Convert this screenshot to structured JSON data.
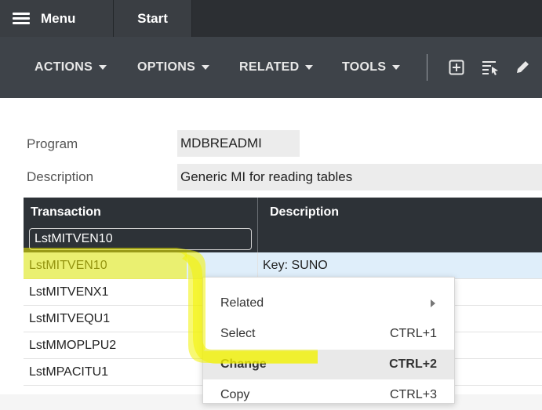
{
  "topbar": {
    "menu_label": "Menu",
    "start_label": "Start"
  },
  "toolbar": {
    "actions_label": "ACTIONS",
    "options_label": "OPTIONS",
    "related_label": "RELATED",
    "tools_label": "TOOLS",
    "icons": [
      "add-icon",
      "select-list-icon",
      "edit-pencil-icon"
    ]
  },
  "form": {
    "program_label": "Program",
    "program_value": "MDBREADMI",
    "description_label": "Description",
    "description_value": "Generic MI for reading tables"
  },
  "grid": {
    "columns": [
      "Transaction",
      "Description"
    ],
    "filter_value": "LstMITVEN10",
    "rows": [
      {
        "transaction": "LstMITVEN10",
        "description": "Key: SUNO",
        "selected": true
      },
      {
        "transaction": "LstMITVENX1",
        "description": ""
      },
      {
        "transaction": "LstMITVEQU1",
        "description": ""
      },
      {
        "transaction": "LstMMOPLPU2",
        "description": ""
      },
      {
        "transaction": "LstMPACITU1",
        "description": ""
      }
    ]
  },
  "context_menu": {
    "items": [
      {
        "label": "Related",
        "shortcut": ""
      },
      {
        "label": "Select",
        "shortcut": "CTRL+1"
      },
      {
        "label": "Change",
        "shortcut": "CTRL+2"
      },
      {
        "label": "Copy",
        "shortcut": "CTRL+3"
      }
    ]
  },
  "colors": {
    "topbar": "#2c2f33",
    "toolbar": "#3e4349",
    "grid_header": "#2d3237",
    "selected_row": "#dfeefa",
    "highlighter": "#f2f200"
  }
}
